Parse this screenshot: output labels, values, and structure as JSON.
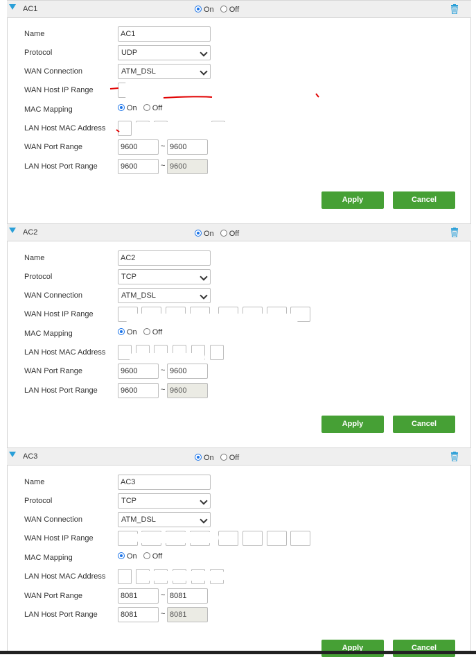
{
  "on_label": "On",
  "off_label": "Off",
  "labels": {
    "name": "Name",
    "protocol": "Protocol",
    "wan_connection": "WAN Connection",
    "wan_host_ip_range": "WAN Host IP Range",
    "mac_mapping": "MAC Mapping",
    "lan_host_mac": "LAN Host MAC Address",
    "wan_port_range": "WAN Port Range",
    "lan_host_port_range": "LAN Host Port Range"
  },
  "buttons": {
    "apply": "Apply",
    "cancel": "Cancel"
  },
  "range_sep": "~",
  "rules": [
    {
      "title": "AC1",
      "enabled": "On",
      "name": "AC1",
      "protocol": "UDP",
      "wan_connection": "ATM_DSL",
      "mac_mapping": "On",
      "wan_port_start": "9600",
      "wan_port_end": "9600",
      "lan_port_start": "9600",
      "lan_port_end": "9600"
    },
    {
      "title": "AC2",
      "enabled": "On",
      "name": "AC2",
      "protocol": "TCP",
      "wan_connection": "ATM_DSL",
      "mac_mapping": "On",
      "wan_port_start": "9600",
      "wan_port_end": "9600",
      "lan_port_start": "9600",
      "lan_port_end": "9600"
    },
    {
      "title": "AC3",
      "enabled": "On",
      "name": "AC3",
      "protocol": "TCP",
      "wan_connection": "ATM_DSL",
      "mac_mapping": "On",
      "wan_port_start": "8081",
      "wan_port_end": "8081",
      "lan_port_start": "8081",
      "lan_port_end": "8081"
    }
  ],
  "icons": {
    "collapse": "caret-down-icon",
    "delete": "trash-icon"
  },
  "colors": {
    "accent": "#2a9fd8",
    "button": "#46a035",
    "header_bg": "#efefef"
  }
}
